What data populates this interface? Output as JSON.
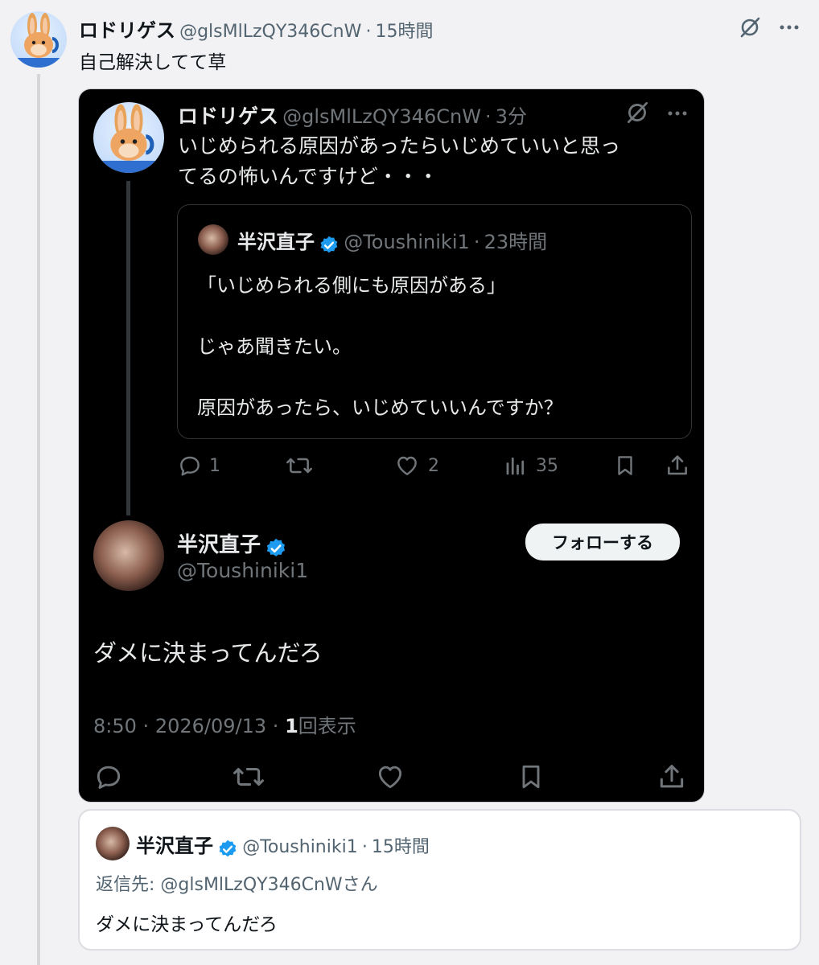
{
  "outer_tweet": {
    "display_name": "ロドリゲス",
    "handle": "@glsMlLzQY346CnW",
    "separator": "·",
    "time": "15時間",
    "text": "自己解決してて草"
  },
  "inner_tweet": {
    "display_name": "ロドリゲス",
    "handle": "@glsMlLzQY346CnW",
    "separator": "·",
    "time": "3分",
    "text_line1": "いじめられる原因があったらいじめていいと思っ",
    "text_line2": "てるの怖いんですけど・・・",
    "quote": {
      "display_name": "半沢直子",
      "handle": "@Toushiniki1",
      "separator": "·",
      "time": "23時間",
      "line1": "「いじめられる側にも原因がある」",
      "line2": "じゃあ聞きたい。",
      "line3": "原因があったら、いじめていいんですか？"
    },
    "actions": {
      "replies": "1",
      "likes": "2",
      "views": "35"
    }
  },
  "reply_tweet": {
    "display_name": "半沢直子",
    "handle": "@Toushiniki1",
    "follow_label": "フォローする",
    "text": "ダメに決まってんだろ",
    "time": "8:50",
    "separator1": "·",
    "date": "2026/09/13",
    "separator2": "·",
    "views_count": "1",
    "views_label": "回表示"
  },
  "bottom_tweet": {
    "display_name": "半沢直子",
    "handle": "@Toushiniki1",
    "separator": "·",
    "time": "15時間",
    "reply_to_prefix": "返信先: ",
    "reply_to_handle": "@glsMlLzQY346CnW",
    "reply_to_suffix": "さん",
    "text": "ダメに決まってんだろ"
  },
  "colors": {
    "verified": "#1d9bf0",
    "dark_bg": "#000000",
    "page_bg": "#f2f2f4"
  },
  "icons": [
    "grok-icon",
    "more-icon",
    "reply-icon",
    "retweet-icon",
    "like-icon",
    "views-icon",
    "bookmark-icon",
    "share-icon",
    "verified-badge-icon"
  ]
}
